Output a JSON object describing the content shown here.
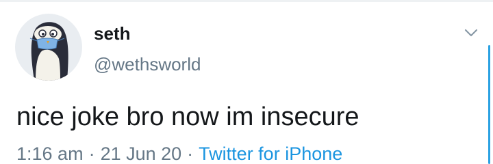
{
  "tweet": {
    "display_name": "seth",
    "handle": "@wethsworld",
    "text": "nice joke bro now im insecure",
    "time": "1:16 am",
    "date": "21 Jun 20",
    "source": "Twitter for iPhone",
    "separator": "·"
  },
  "icons": {
    "more": "chevron-down-icon",
    "avatar": "penguin-avatar"
  },
  "colors": {
    "text_primary": "#14171a",
    "text_secondary": "#657786",
    "link": "#1b95e0",
    "scrollbar": "#2aa1e2"
  }
}
